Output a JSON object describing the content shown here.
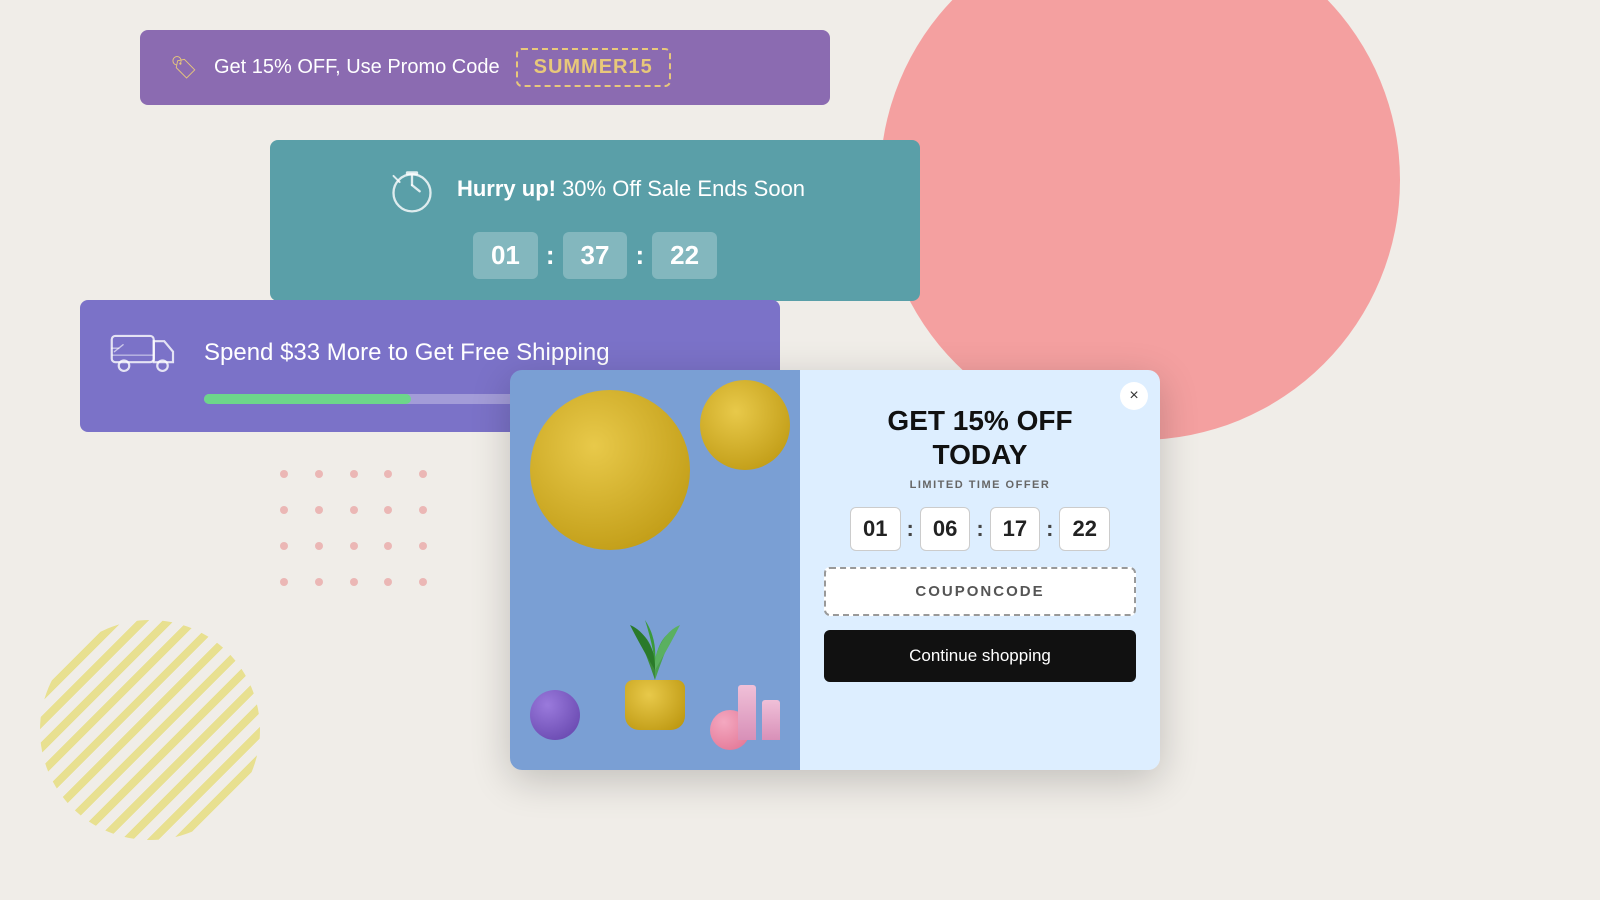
{
  "background": {
    "color": "#f0ede8"
  },
  "promo_banner": {
    "text": "Get 15% OFF, Use Promo Code",
    "code": "SUMMER15",
    "bg_color": "#8b6bb1"
  },
  "countdown_banner": {
    "title_bold": "Hurry up!",
    "title_rest": " 30% Off Sale Ends Soon",
    "bg_color": "#5a9fa8",
    "hours": "01",
    "minutes": "37",
    "seconds": "22"
  },
  "shipping_banner": {
    "text": "Spend $33 More to Get Free Shipping",
    "bg_color": "#7b72c8",
    "progress_percent": 38
  },
  "modal": {
    "title_line1": "GET 15% OFF",
    "title_line2": "TODAY",
    "subtitle": "LIMITED TIME OFFER",
    "hours": "01",
    "minutes": "06",
    "tens_seconds": "17",
    "seconds": "22",
    "coupon_label": "COUPONCODE",
    "continue_label": "Continue shopping",
    "close_label": "×"
  },
  "icons": {
    "tag": "🏷",
    "stopwatch": "⏱",
    "truck": "🚚",
    "close": "×"
  }
}
